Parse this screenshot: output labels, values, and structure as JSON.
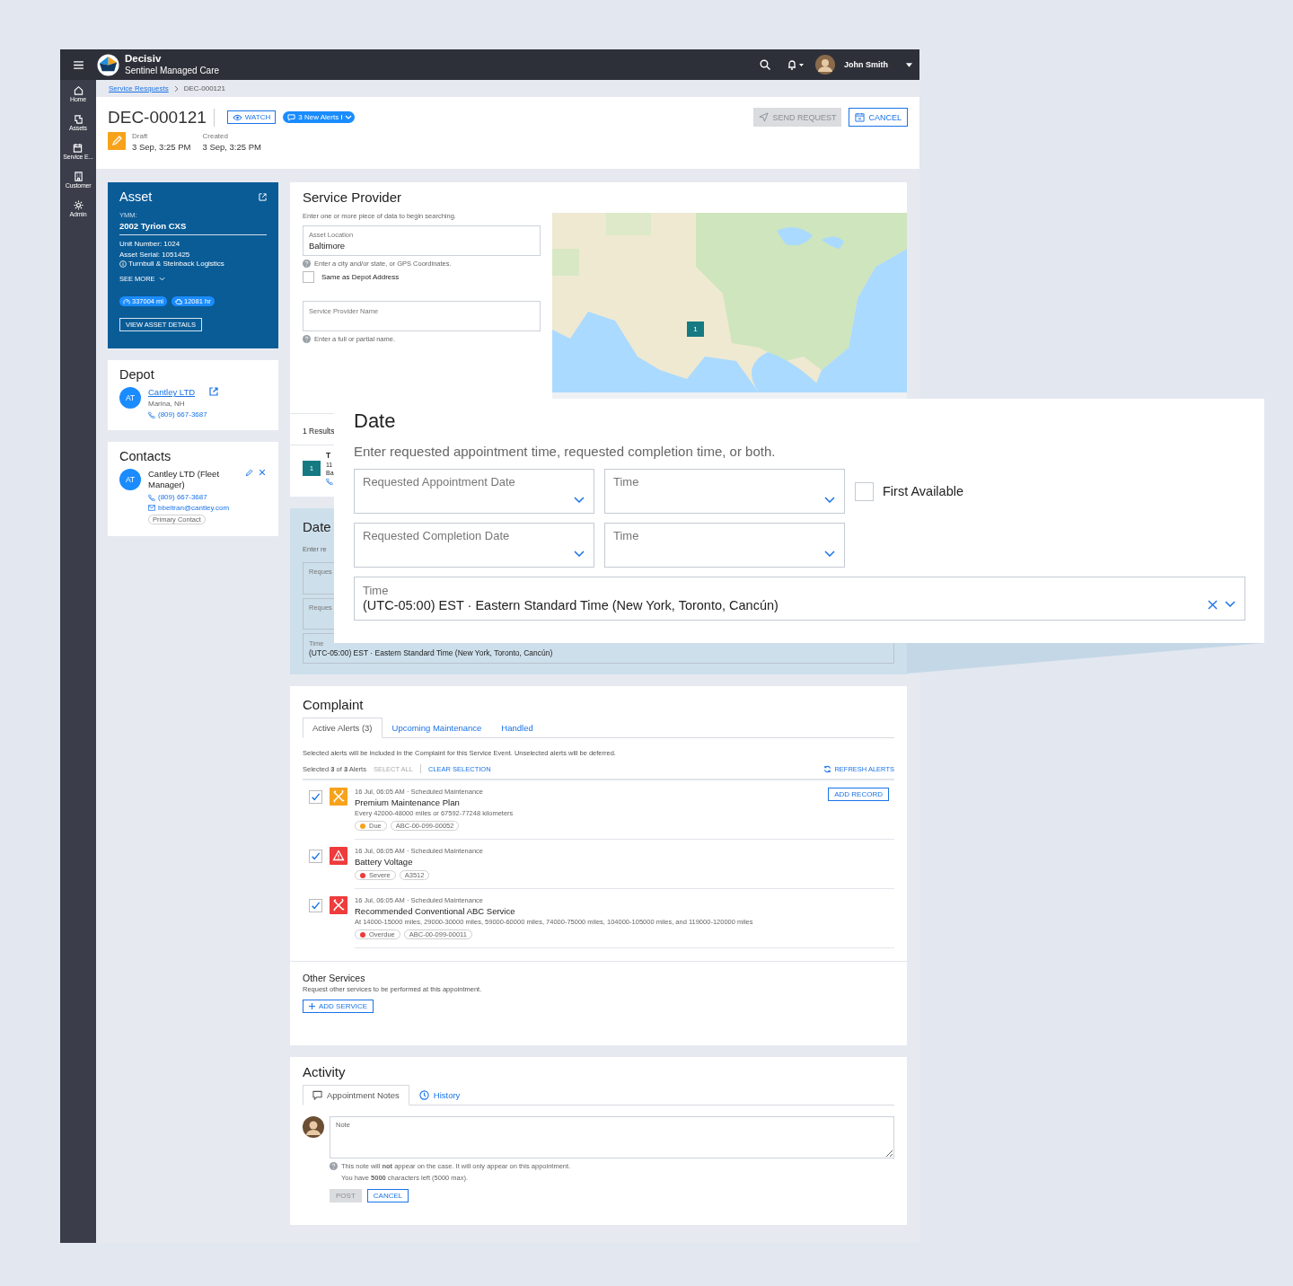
{
  "app": {
    "name": "Decisiv",
    "subtitle": "Sentinel Managed Care"
  },
  "topbar": {
    "user": "John Smith"
  },
  "sidebar": {
    "items": [
      {
        "label": "Home"
      },
      {
        "label": "Assets"
      },
      {
        "label": "Service E..."
      },
      {
        "label": "Customer"
      },
      {
        "label": "Admin"
      }
    ]
  },
  "breadcrumb": [
    {
      "label": "Service Resquests"
    },
    {
      "label": "DEC-000121"
    }
  ],
  "header": {
    "title": "DEC-000121",
    "watch": "WATCH",
    "alerts": "3 New Alerts",
    "send_request": {
      "label": "SEND REQUEST",
      "disabled": true
    },
    "cancel": "CANCEL",
    "meta": [
      {
        "label": "Draft",
        "value": "3 Sep, 3:25 PM"
      },
      {
        "label": "Created",
        "value": "3 Sep, 3:25 PM"
      }
    ]
  },
  "asset": {
    "title": "Asset",
    "ymm_label": "YMM:",
    "ymm": "2002 Tyrion CXS",
    "lines": [
      "Unit Number: 1024",
      "Asset Serial: 1051425"
    ],
    "owner": "Turnbull & Steinback Logistics",
    "see_more": "SEE MORE",
    "meters": [
      "337004 mi",
      "12081 hr"
    ],
    "details_button": "VIEW ASSET DETAILS"
  },
  "depot": {
    "title": "Depot",
    "initials": "AT",
    "name": "Cantley LTD",
    "location": "Marina, NH",
    "phone": "(809) 667-3687"
  },
  "contacts": {
    "title": "Contacts",
    "items": [
      {
        "initials": "AT",
        "name": "Cantley LTD (Fleet Manager)",
        "phone": "(809) 667-3687",
        "email": "bbeltran@cantley.com",
        "tag": "Primary Contact"
      }
    ]
  },
  "service_provider": {
    "title": "Service Provider",
    "hint": "Enter one or more piece of data to begin searching.",
    "asset_location": {
      "label": "Asset Location",
      "value": "Baltimore"
    },
    "location_help": "Enter a city and/or state, or GPS Coordinates.",
    "same_as_depot": {
      "label": "Same as Depot Address",
      "checked": false
    },
    "provider_name": {
      "placeholder": "Service Provider Name"
    },
    "name_help": "Enter a full or partial name.",
    "map": {
      "kind": "picture",
      "marker": "1"
    },
    "results": {
      "count": "1 Results",
      "items": [
        {
          "marker": "1",
          "title": "T",
          "line_1": "11",
          "line_2": "Ba"
        }
      ]
    }
  },
  "date_section": {
    "title": "Date",
    "hint": "Enter re",
    "fields": [
      "Reques",
      "Reques"
    ],
    "timezone": {
      "label": "Time",
      "value": "(UTC-05:00) EST · Eastern Standard Time (New York, Toronto, Cancún)"
    }
  },
  "date_zoom": {
    "title": "Date",
    "hint": "Enter requested appointment time, requested completion time, or both.",
    "rows": [
      {
        "date_label": "Requested Appointment Date",
        "time_label": "Time"
      },
      {
        "date_label": "Requested Completion Date",
        "time_label": "Time"
      }
    ],
    "first_available": {
      "label": "First Available",
      "checked": false
    },
    "timezone": {
      "label": "Time",
      "value": "(UTC-05:00) EST · Eastern Standard Time (New York, Toronto, Cancún)"
    }
  },
  "complaint": {
    "title": "Complaint",
    "tabs": [
      {
        "label": "Active Alerts (3)",
        "selected": true
      },
      {
        "label": "Upcoming Maintenance",
        "selected": false
      },
      {
        "label": "Handled",
        "selected": false
      }
    ],
    "info": "Selected alerts will be included in the Complaint for this Service Event. Unselected alerts will be deferred.",
    "selection": "Selected **3** of **3** Alerts",
    "select_all": {
      "label": "SELECT ALL",
      "disabled": true
    },
    "clear": "CLEAR SELECTION",
    "refresh": "REFRESH ALERTS",
    "alerts": [
      {
        "checked": true,
        "kind": "tools",
        "color": "#f7a21b",
        "meta": "16 Jul, 06:05 AM · Scheduled Maintenance",
        "title": "Premium Maintenance Plan",
        "detail": "Every 42000-48000 miles or 67592-77248 kilometers",
        "status": {
          "label": "Due",
          "color": "#f7a21b"
        },
        "code": "ABC-00-099-00052",
        "action": "ADD RECORD"
      },
      {
        "checked": true,
        "kind": "warning",
        "color": "#ee3b3b",
        "meta": "16 Jul, 06:05 AM · Scheduled Maintenance",
        "title": "Battery Voltage",
        "status": {
          "label": "Severe",
          "color": "#ee3b3b"
        },
        "code": "A3512"
      },
      {
        "checked": true,
        "kind": "tools",
        "color": "#ee3b3b",
        "meta": "16 Jul, 06:05 AM · Scheduled Maintenance",
        "title": "Recommended Conventional ABC Service",
        "detail": "At 14000-15000 miles, 29000-30000 miles, 59000-60000 miles, 74000-75000 miles, 104000-105000 miles, and 119000-120000 miles",
        "status": {
          "label": "Overdue",
          "color": "#ee3b3b"
        },
        "code": "ABC-00-099-00011"
      }
    ],
    "other_services": {
      "title": "Other Services",
      "hint": "Request other services to be performed at this appointment.",
      "button": "ADD SERVICE"
    }
  },
  "activity": {
    "title": "Activity",
    "tabs": [
      {
        "label": "Appointment Notes",
        "selected": true
      },
      {
        "label": "History",
        "selected": false
      }
    ],
    "note_placeholder": "Note",
    "help": "This note will **not** appear on the case. It will only appear on this appointment.",
    "count": "You have **5000** characters left (5000 max).",
    "post": {
      "label": "POST",
      "disabled": true
    },
    "cancel": "CANCEL"
  }
}
